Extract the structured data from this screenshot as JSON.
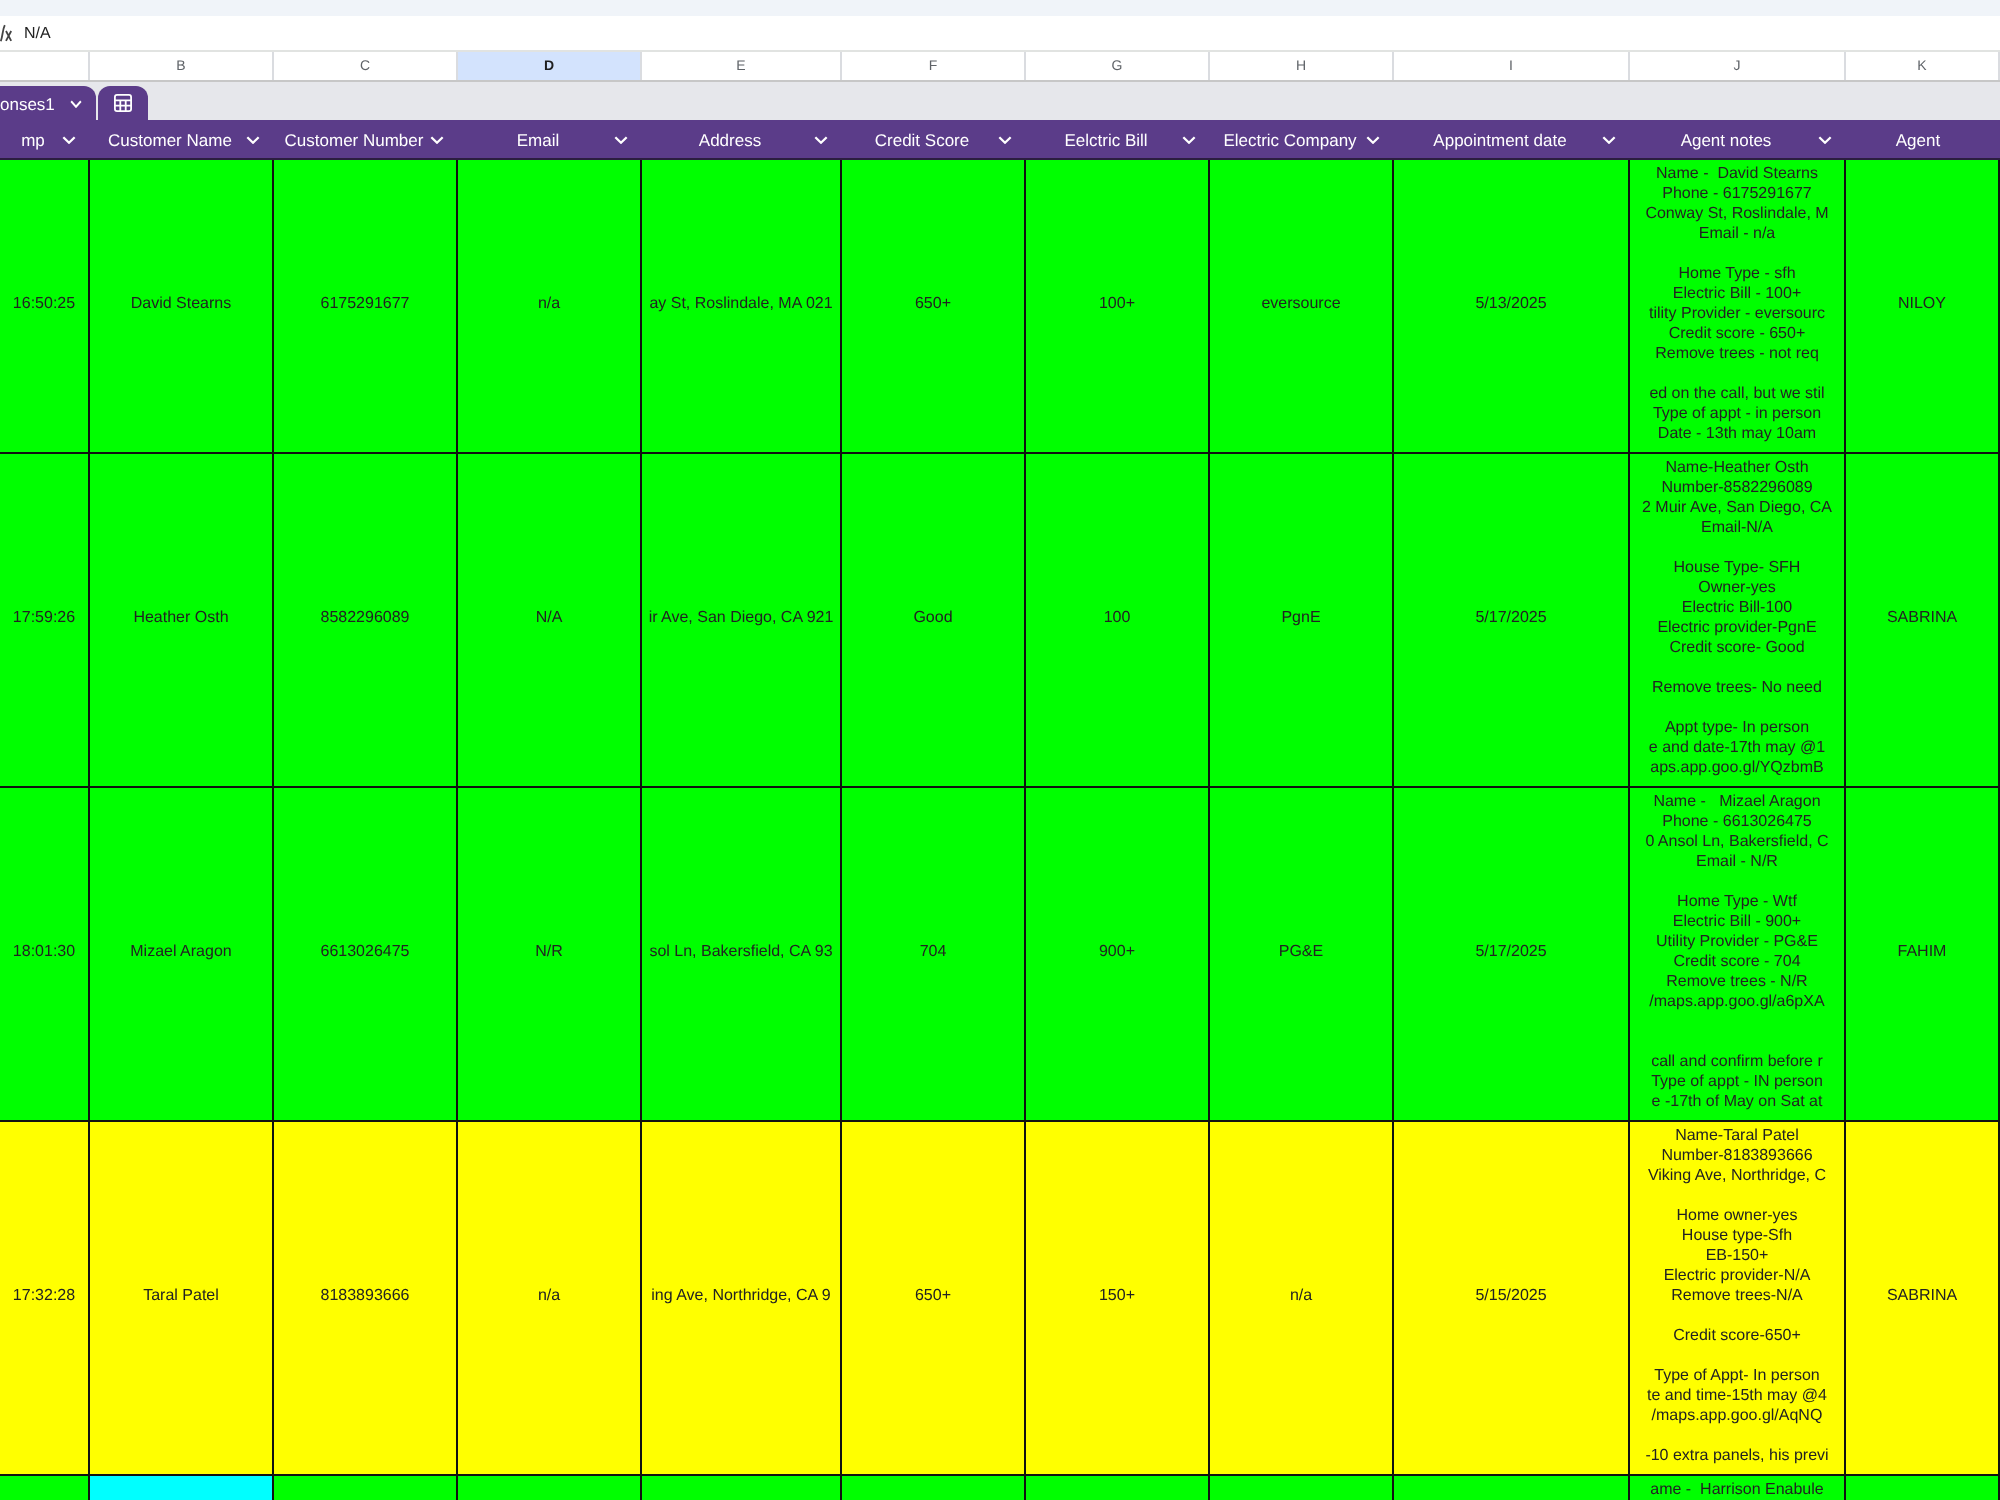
{
  "formula_bar": {
    "value": "N/A"
  },
  "column_letters": [
    {
      "letter": "B",
      "selected": false
    },
    {
      "letter": "C",
      "selected": false
    },
    {
      "letter": "D",
      "selected": true
    },
    {
      "letter": "E",
      "selected": false
    },
    {
      "letter": "F",
      "selected": false
    },
    {
      "letter": "G",
      "selected": false
    },
    {
      "letter": "H",
      "selected": false
    },
    {
      "letter": "I",
      "selected": false
    },
    {
      "letter": "J",
      "selected": false
    },
    {
      "letter": "K",
      "selected": false
    }
  ],
  "table_tab": {
    "label": "onses1"
  },
  "table": {
    "headers": [
      {
        "label": "mp",
        "dropdown": true
      },
      {
        "label": "Customer Name",
        "dropdown": true
      },
      {
        "label": "Customer Number",
        "dropdown": true
      },
      {
        "label": "Email",
        "dropdown": true
      },
      {
        "label": "Address",
        "dropdown": true
      },
      {
        "label": "Credit Score",
        "dropdown": true
      },
      {
        "label": "Eelctric Bill",
        "dropdown": true
      },
      {
        "label": "Electric Company",
        "dropdown": true
      },
      {
        "label": "Appointment date",
        "dropdown": true
      },
      {
        "label": "Agent notes",
        "dropdown": true
      },
      {
        "label": "Agent",
        "dropdown": false
      }
    ],
    "rows": [
      {
        "color": "#00ff00",
        "cells": [
          "16:50:25",
          "David Stearns",
          "6175291677",
          "n/a",
          "ay St, Roslindale, MA 021",
          "650+",
          "100+",
          "eversource",
          "5/13/2025",
          "Name -  David Stearns\nPhone - 6175291677\nConway St, Roslindale, M\nEmail - n/a\n\nHome Type - sfh\nElectric Bill - 100+\ntility Provider - eversourc\nCredit score - 650+\nRemove trees - not req\n\ned on the call, but we stil\nType of appt - in person\nDate - 13th may 10am",
          "NILOY"
        ]
      },
      {
        "color": "#00ff00",
        "cells": [
          "17:59:26",
          "Heather Osth",
          "8582296089",
          "N/A",
          "ir Ave, San Diego, CA 921",
          "Good",
          "100",
          "PgnE",
          "5/17/2025",
          "Name-Heather Osth\nNumber-8582296089\n2 Muir Ave, San Diego, CA\nEmail-N/A\n\nHouse Type- SFH\nOwner-yes\nElectric Bill-100\nElectric provider-PgnE\nCredit score- Good\n\nRemove trees- No need\n\nAppt type- In person\ne and date-17th may @1\naps.app.goo.gl/YQzbmB",
          "SABRINA"
        ]
      },
      {
        "color": "#00ff00",
        "cells": [
          "18:01:30",
          "Mizael Aragon",
          "6613026475",
          "N/R",
          "sol Ln, Bakersfield, CA 93",
          "704",
          "900+",
          "PG&E",
          "5/17/2025",
          "Name -   Mizael Aragon\nPhone - 6613026475\n0 Ansol Ln, Bakersfield, C\nEmail - N/R\n\nHome Type - Wtf\nElectric Bill - 900+\nUtility Provider - PG&E\nCredit score - 704\nRemove trees - N/R\n/maps.app.goo.gl/a6pXA\n\n\ncall and confirm before r\nType of appt - IN person\ne -17th of May on Sat at",
          "FAHIM"
        ]
      },
      {
        "color": "#ffff00",
        "cells": [
          "17:32:28",
          "Taral Patel",
          "8183893666",
          "n/a",
          "ing Ave, Northridge, CA 9",
          "650+",
          "150+",
          "n/a",
          "5/15/2025",
          "Name-Taral Patel\nNumber-8183893666\nViking Ave, Northridge, C\n\nHome owner-yes\nHouse type-Sfh\nEB-150+\nElectric provider-N/A\nRemove trees-N/A\n\nCredit score-650+\n\nType of Appt- In person\nte and time-15th may @4\n/maps.app.goo.gl/AqNQ\n\n-10 extra panels, his previ",
          "SABRINA"
        ]
      },
      {
        "color": "#00ff00",
        "cells": [
          null,
          {
            "color": "#00ffff"
          },
          null,
          null,
          null,
          null,
          null,
          null,
          null,
          "ame -  Harrison Enabule",
          null
        ]
      }
    ]
  }
}
